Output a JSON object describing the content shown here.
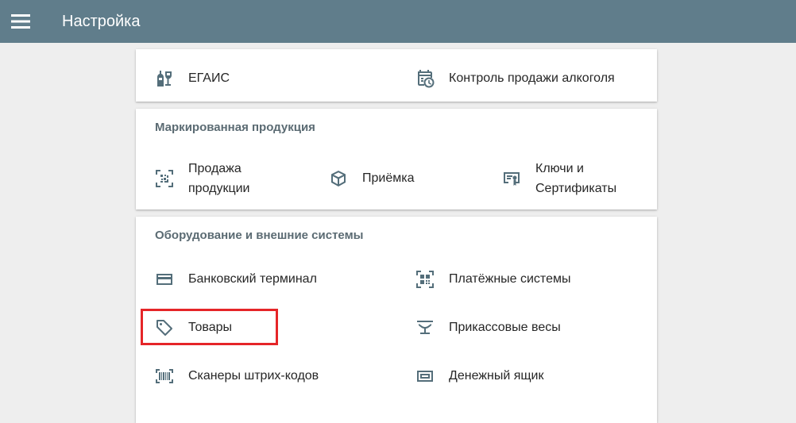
{
  "header": {
    "title": "Настройка",
    "background": "#607d8b",
    "menu_icon": "hamburger-menu-icon"
  },
  "sections": [
    {
      "title": "",
      "items": [
        {
          "label": "ЕГАИС",
          "icon": "wine-bottle-glass-icon"
        },
        {
          "label": "Контроль продажи алкоголя",
          "icon": "calendar-clock-icon"
        }
      ]
    },
    {
      "title": "Маркированная продукция",
      "items": [
        {
          "label": "Продажа продукции",
          "label_lines": [
            "Продажа",
            "продукции"
          ],
          "icon": "datamatrix-scan-icon"
        },
        {
          "label": "Приёмка",
          "icon": "package-box-icon"
        },
        {
          "label": "Ключи и Сертификаты",
          "label_lines": [
            "Ключи и",
            "Сертификаты"
          ],
          "icon": "certificate-card-icon"
        }
      ]
    },
    {
      "title": "Оборудование и внешние системы",
      "items": [
        {
          "label": "Банковский терминал",
          "icon": "credit-card-icon"
        },
        {
          "label": "Платёжные системы",
          "icon": "qr-code-scan-icon"
        },
        {
          "label": "Товары",
          "icon": "price-tag-icon",
          "highlighted": true
        },
        {
          "label": "Прикассовые весы",
          "icon": "scale-icon"
        },
        {
          "label": "Сканеры штрих-кодов",
          "icon": "barcode-scanner-icon"
        },
        {
          "label": "Денежный ящик",
          "icon": "cash-drawer-icon"
        }
      ]
    }
  ],
  "colors": {
    "accent_highlight": "#e52528",
    "icon": "#546e7a",
    "section_title": "#5b6b73",
    "background": "#eeeeee"
  }
}
